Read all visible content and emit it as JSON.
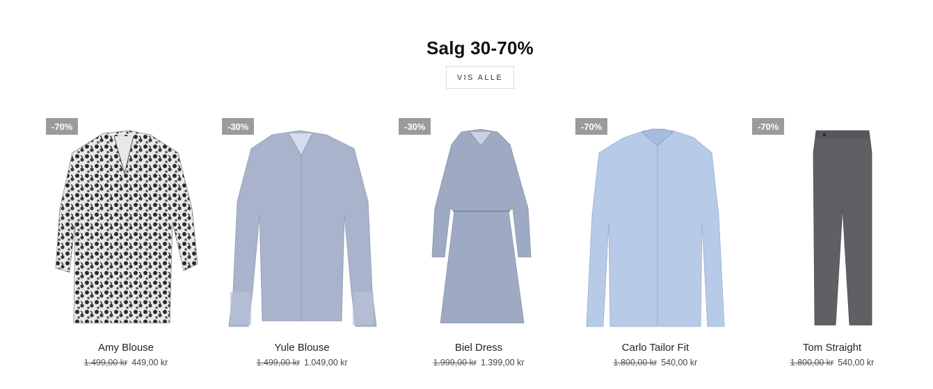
{
  "section": {
    "title": "Salg 30-70%",
    "view_all_label": "VIS ALLE"
  },
  "products": [
    {
      "name": "Amy Blouse",
      "discount": "-70%",
      "old_price": "1.499,00 kr",
      "price": "449,00 kr",
      "image": "floral-blouse"
    },
    {
      "name": "Yule Blouse",
      "discount": "-30%",
      "old_price": "1.499,00 kr",
      "price": "1.049,00 kr",
      "image": "blue-blouse"
    },
    {
      "name": "Biel Dress",
      "discount": "-30%",
      "old_price": "1.999,00 kr",
      "price": "1.399,00 kr",
      "image": "blue-dress"
    },
    {
      "name": "Carlo Tailor Fit",
      "discount": "-70%",
      "old_price": "1.800,00 kr",
      "price": "540,00 kr",
      "image": "light-blue-shirt"
    },
    {
      "name": "Tom Straight",
      "discount": "-70%",
      "old_price": "1.800,00 kr",
      "price": "540,00 kr",
      "image": "grey-trousers"
    }
  ],
  "colors": {
    "badge_bg": "#9b9b9b",
    "floral": "#6f6f6f",
    "blouse": "#a9b4cc",
    "dress": "#9eaac3",
    "shirt": "#b7cbe8",
    "trousers": "#5e6064"
  }
}
